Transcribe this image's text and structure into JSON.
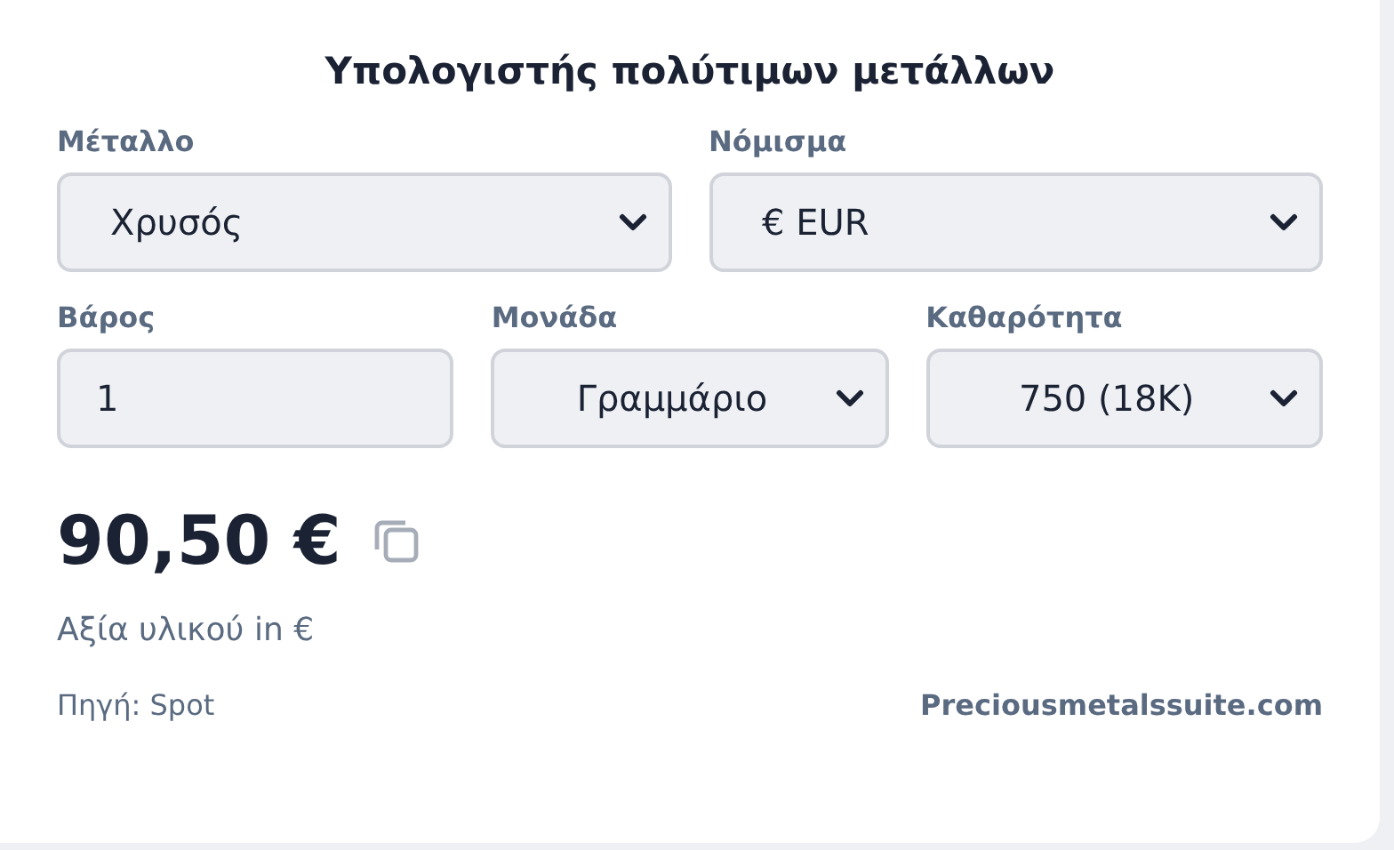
{
  "title": "Υπολογιστής πολύτιμων μετάλλων",
  "rows": [
    [
      {
        "label": "Μέταλλο",
        "kind": "select",
        "value": "Χρυσός"
      },
      {
        "label": "Νόμισμα",
        "kind": "select",
        "value": "€ EUR"
      }
    ],
    [
      {
        "label": "Βάρος",
        "kind": "input",
        "value": "1"
      },
      {
        "label": "Μονάδα",
        "kind": "select",
        "value": "Γραμμάριο"
      },
      {
        "label": "Καθαρότητα",
        "kind": "select",
        "value": "750 (18K)"
      }
    ]
  ],
  "result": {
    "price": "90,50 €",
    "caption": "Αξία υλικού in €"
  },
  "footer": {
    "source": "Πηγή: Spot",
    "link": "Preciousmetalssuite.com"
  }
}
